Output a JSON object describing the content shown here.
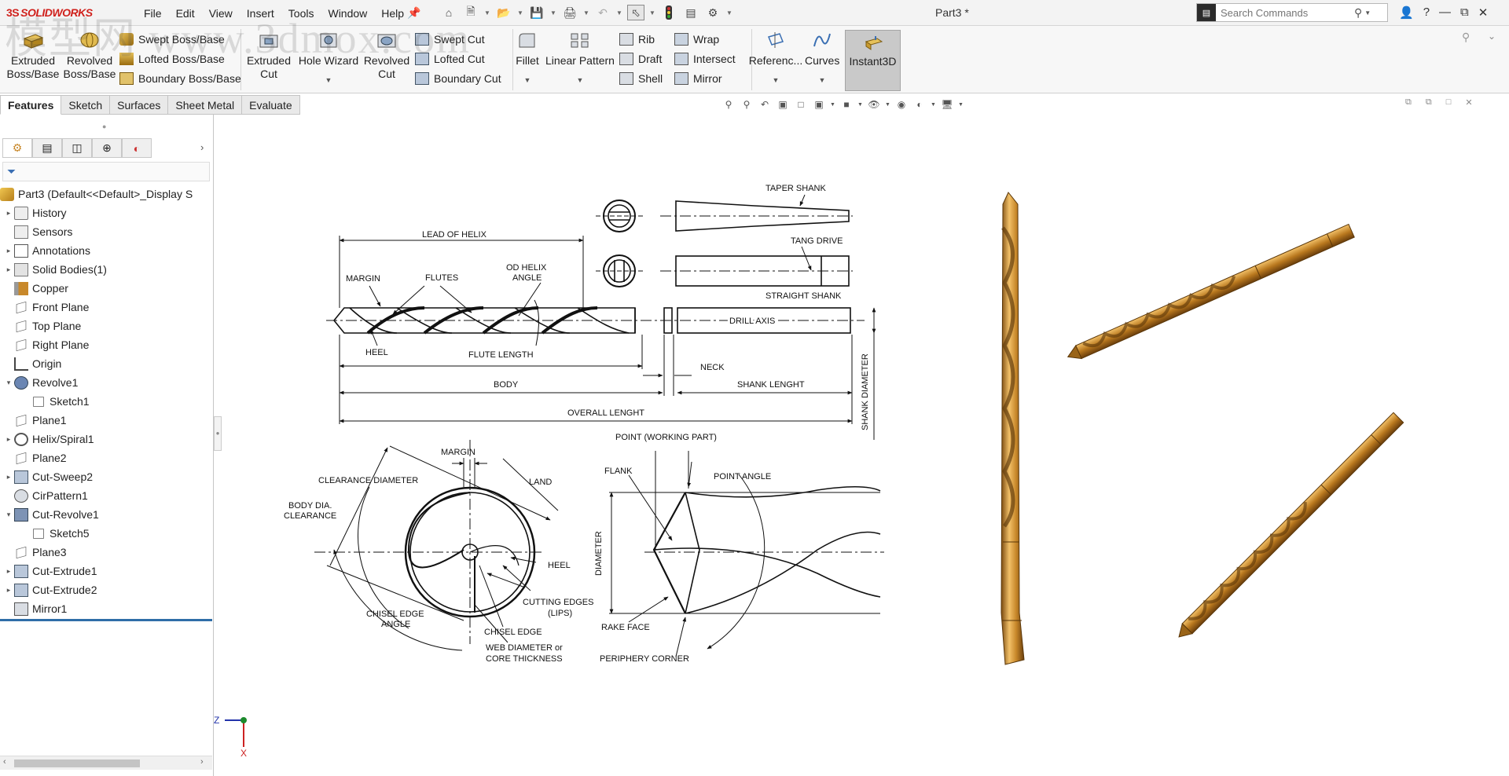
{
  "titlebar": {
    "logo_ds": "3S",
    "logo_text": "SOLIDWORKS",
    "menu": [
      "File",
      "Edit",
      "View",
      "Insert",
      "Tools",
      "Window",
      "Help"
    ],
    "document_title": "Part3 *",
    "search_placeholder": "Search Commands",
    "watermark": "模型网 www.3dmox.com"
  },
  "command_manager": {
    "extruded_boss": "Extruded Boss/Base",
    "revolved_boss": "Revolved Boss/Base",
    "swept_boss": "Swept Boss/Base",
    "lofted_boss": "Lofted Boss/Base",
    "boundary_boss": "Boundary Boss/Base",
    "extruded_cut": "Extruded Cut",
    "hole_wizard": "Hole Wizard",
    "revolved_cut": "Revolved Cut",
    "swept_cut": "Swept Cut",
    "lofted_cut": "Lofted Cut",
    "boundary_cut": "Boundary Cut",
    "fillet": "Fillet",
    "linear_pattern": "Linear Pattern",
    "rib": "Rib",
    "draft": "Draft",
    "shell": "Shell",
    "wrap": "Wrap",
    "intersect": "Intersect",
    "mirror": "Mirror",
    "reference": "Referenc...",
    "curves": "Curves",
    "instant3d": "Instant3D"
  },
  "tabs": [
    "Features",
    "Sketch",
    "Surfaces",
    "Sheet Metal",
    "Evaluate"
  ],
  "feature_tree": {
    "root": "Part3  (Default<<Default>_Display S",
    "items": [
      {
        "label": "History",
        "icon": "history-icon",
        "expander": true,
        "indent": 0
      },
      {
        "label": "Sensors",
        "icon": "sensors-icon",
        "expander": false,
        "indent": 0
      },
      {
        "label": "Annotations",
        "icon": "annotations-icon",
        "expander": true,
        "indent": 0
      },
      {
        "label": "Solid Bodies(1)",
        "icon": "solid-bodies-icon",
        "expander": true,
        "indent": 0
      },
      {
        "label": "Copper",
        "icon": "material-icon",
        "expander": false,
        "indent": 0
      },
      {
        "label": "Front Plane",
        "icon": "plane-icon",
        "expander": false,
        "indent": 0
      },
      {
        "label": "Top Plane",
        "icon": "plane-icon",
        "expander": false,
        "indent": 0
      },
      {
        "label": "Right Plane",
        "icon": "plane-icon",
        "expander": false,
        "indent": 0
      },
      {
        "label": "Origin",
        "icon": "origin-icon",
        "expander": false,
        "indent": 0
      },
      {
        "label": "Revolve1",
        "icon": "revolve-icon",
        "expander": "open",
        "indent": 0
      },
      {
        "label": "Sketch1",
        "icon": "sketch-icon",
        "expander": false,
        "indent": 1
      },
      {
        "label": "Plane1",
        "icon": "plane-icon",
        "expander": false,
        "indent": 0
      },
      {
        "label": "Helix/Spiral1",
        "icon": "helix-icon",
        "expander": true,
        "indent": 0
      },
      {
        "label": "Plane2",
        "icon": "plane-icon",
        "expander": false,
        "indent": 0
      },
      {
        "label": "Cut-Sweep2",
        "icon": "cut-sweep-icon",
        "expander": true,
        "indent": 0
      },
      {
        "label": "CirPattern1",
        "icon": "circular-pattern-icon",
        "expander": false,
        "indent": 0
      },
      {
        "label": "Cut-Revolve1",
        "icon": "cut-revolve-icon",
        "expander": "open",
        "indent": 0
      },
      {
        "label": "Sketch5",
        "icon": "sketch-icon",
        "expander": false,
        "indent": 1
      },
      {
        "label": "Plane3",
        "icon": "plane-icon",
        "expander": false,
        "indent": 0
      },
      {
        "label": "Cut-Extrude1",
        "icon": "cut-extrude-icon",
        "expander": true,
        "indent": 0
      },
      {
        "label": "Cut-Extrude2",
        "icon": "cut-extrude-icon",
        "expander": true,
        "indent": 0
      },
      {
        "label": "Mirror1",
        "icon": "mirror-icon",
        "expander": false,
        "indent": 0
      }
    ]
  },
  "drawing_labels": {
    "taper_shank": "TAPER SHANK",
    "tang_drive": "TANG DRIVE",
    "straight_shank": "STRAIGHT SHANK",
    "lead_of_helix": "LEAD OF HELIX",
    "margin": "MARGIN",
    "flutes": "FLUTES",
    "od_helix_angle_1": "OD HELIX",
    "od_helix_angle_2": "ANGLE",
    "drill_axis": "DRILL AXIS",
    "heel": "HEEL",
    "flute_length": "FLUTE LENGTH",
    "neck": "NECK",
    "body": "BODY",
    "shank_lenght": "SHANK LENGHT",
    "overall_lenght": "OVERALL LENGHT",
    "shank_diameter": "SHANK DIAMETER",
    "margin2": "MARGIN",
    "clearance_diameter": "CLEARANCE DIAMETER",
    "land": "LAND",
    "body_dia_1": "BODY DIA.",
    "body_dia_2": "CLEARANCE",
    "heel2": "HEEL",
    "cutting_edges_1": "CUTTING EDGES",
    "cutting_edges_2": "(LIPS)",
    "chisel_edge_angle_1": "CHISEL EDGE",
    "chisel_edge_angle_2": "ANGLE",
    "chisel_edge": "CHISEL EDGE",
    "web_diameter_1": "WEB DIAMETER or",
    "web_diameter_2": "CORE THICKNESS",
    "point_working": "POINT (WORKING PART)",
    "flank": "FLANK",
    "point_angle": "POINT ANGLE",
    "diameter": "DIAMETER",
    "rake_face": "RAKE FACE",
    "periphery_corner": "PERIPHERY CORNER"
  },
  "triad": {
    "z": "Z",
    "x": "X"
  },
  "colors": {
    "accent_blue": "#2f6ea8",
    "copper": "#c8882a",
    "copper_dark": "#7a4a10",
    "solidworks_red": "#d0211c"
  }
}
